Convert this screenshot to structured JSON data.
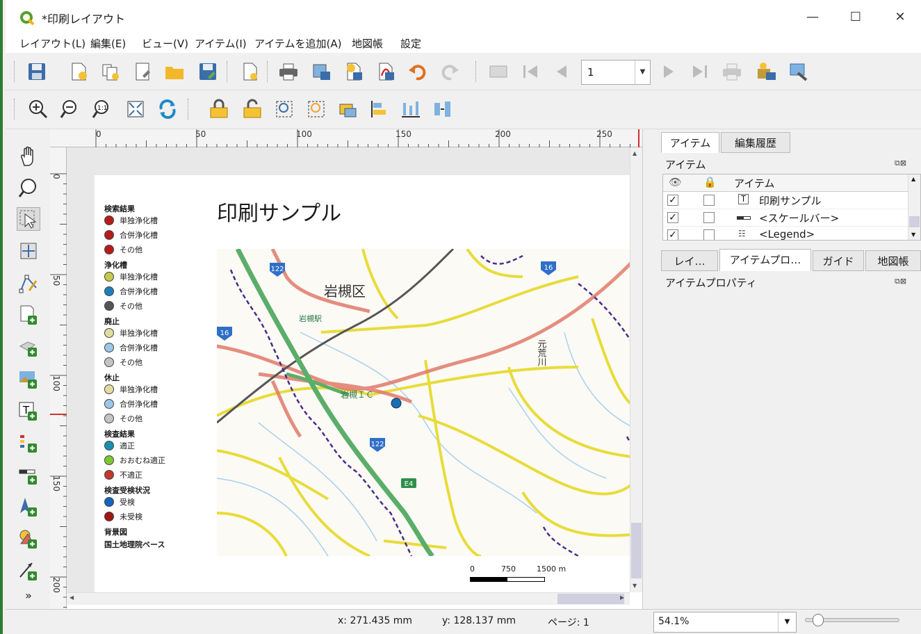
{
  "window": {
    "title": "*印刷レイアウト",
    "controls": [
      "—",
      "☐",
      "✕"
    ]
  },
  "menu": [
    "レイアウト(L)",
    "編集(E)",
    "ビュー(V)",
    "アイテム(I)",
    "アイテムを追加(A)",
    "地図帳",
    "設定"
  ],
  "atlas": {
    "page": "1"
  },
  "ruler": {
    "h": [
      "0",
      "50",
      "100",
      "150",
      "200",
      "250"
    ],
    "v": [
      "0",
      "50",
      "100",
      "150",
      "200"
    ]
  },
  "layout": {
    "title": "印刷サンプル",
    "legend": [
      {
        "heading": "検索結果",
        "items": [
          {
            "label": "単独浄化槽",
            "color": "#b71c1c"
          },
          {
            "label": "合併浄化槽",
            "color": "#b71c1c"
          },
          {
            "label": "その他",
            "color": "#b71c1c"
          }
        ]
      },
      {
        "heading": "浄化槽",
        "items": [
          {
            "label": "単独浄化槽",
            "color": "#c8c84a"
          },
          {
            "label": "合併浄化槽",
            "color": "#1e7fb8"
          },
          {
            "label": "その他",
            "color": "#555555"
          }
        ]
      },
      {
        "heading": "廃止",
        "items": [
          {
            "label": "単独浄化槽",
            "color": "#e3dca0"
          },
          {
            "label": "合併浄化槽",
            "color": "#9ec6e8"
          },
          {
            "label": "その他",
            "color": "#c4c4c4"
          }
        ]
      },
      {
        "heading": "休止",
        "items": [
          {
            "label": "単独浄化槽",
            "color": "#e3dca0"
          },
          {
            "label": "合併浄化槽",
            "color": "#9ec6e8"
          },
          {
            "label": "その他",
            "color": "#c4c4c4"
          }
        ]
      },
      {
        "heading": "検査結果",
        "items": [
          {
            "label": "適正",
            "color": "#1a8fb0"
          },
          {
            "label": "おおむね適正",
            "color": "#7cc832"
          },
          {
            "label": "不適正",
            "color": "#c0392b"
          }
        ]
      },
      {
        "heading": "検査受検状況",
        "items": [
          {
            "label": "受検",
            "color": "#1565c0"
          },
          {
            "label": "未受検",
            "color": "#a31515"
          }
        ]
      },
      {
        "heading": "背景図",
        "items": []
      },
      {
        "heading": "国土地理院ベース",
        "items": []
      }
    ],
    "map_labels": {
      "district": "岩槻区",
      "station": "岩槻駅",
      "ic": "岩槻ＩＣ",
      "river": "元荒川",
      "route_122a": "122",
      "route_122b": "122",
      "route_16": "16",
      "route_16b": "16",
      "route_e4": "E4"
    },
    "scale": {
      "labels": [
        "0",
        "750",
        "1500 m"
      ]
    }
  },
  "panel": {
    "tabs_top": [
      "アイテム",
      "編集履歴"
    ],
    "items_title": "アイテム",
    "table_header": "アイテム",
    "items": [
      {
        "name": "印刷サンプル",
        "visible": "✓",
        "icon": "text-icon"
      },
      {
        "name": "<スケールバー>",
        "visible": "✓",
        "icon": "scalebar-icon"
      },
      {
        "name": "<Legend>",
        "visible": "✓",
        "icon": "legend-icon"
      }
    ],
    "tabs_bottom": [
      "レイ…",
      "アイテムプロ…",
      "ガイド",
      "地図帳"
    ],
    "props_title": "アイテムプロパティ"
  },
  "status": {
    "x": "x: 271.435 mm",
    "y": "y: 128.137 mm",
    "page": "ページ: 1",
    "zoom": "54.1%",
    "zoom_level": 0.08
  }
}
